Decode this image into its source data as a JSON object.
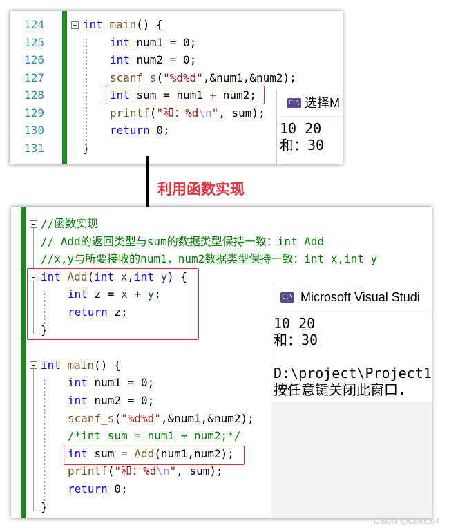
{
  "top_editor": {
    "line_numbers": [
      "124",
      "125",
      "126",
      "127",
      "128",
      "129",
      "130",
      "131"
    ],
    "lines": [
      [
        "kw:int",
        " ",
        "fn:main",
        "() {"
      ],
      [
        "kw:int",
        " num1 = 0;"
      ],
      [
        "kw:int",
        " num2 = 0;"
      ],
      [
        "fn:scanf_s",
        "(",
        "str:\"%d%d\"",
        ",&num1,&num2);"
      ],
      [
        "kw:int",
        " sum = num1 + num2;"
      ],
      [
        "fn:printf",
        "(",
        "str:\"和：%d",
        "esc:\\n",
        "str:\"",
        ", sum);"
      ],
      [
        "kw:return",
        " 0;"
      ],
      [
        "}"
      ]
    ],
    "console": {
      "title": "选择M",
      "output": [
        "10 20",
        "和：30"
      ]
    }
  },
  "arrow_label": "利用函数实现",
  "bottom_editor": {
    "lines": [
      [
        "cm://函数实现"
      ],
      [
        "cm:// Add的返回类型与sum的数据类型保持一致：int Add"
      ],
      [
        "cm://x,y与所要接收的num1，num2数据类型保持一致：int x,int y"
      ],
      [
        "kw:int",
        " ",
        "fn:Add",
        "(",
        "kw:int",
        " ",
        "var:x",
        ",",
        "kw:int",
        " ",
        "var:y",
        ") {"
      ],
      [
        "kw:int",
        " z = ",
        "var:x",
        " + ",
        "var:y",
        ";"
      ],
      [
        "kw:return",
        " z;"
      ],
      [
        "}"
      ],
      [
        ""
      ],
      [
        "kw:int",
        " ",
        "fn:main",
        "() {"
      ],
      [
        "kw:int",
        " num1 = 0;"
      ],
      [
        "kw:int",
        " num2 = 0;"
      ],
      [
        "fn:scanf_s",
        "(",
        "str:\"%d%d\"",
        ",&num1,&num2);"
      ],
      [
        "cm:/*int sum = num1 + num2;*/"
      ],
      [
        "kw:int",
        " sum = ",
        "fn:Add",
        "(num1,num2);"
      ],
      [
        "fn:printf",
        "(",
        "str:\"和：%d",
        "esc:\\n",
        "str:\"",
        ", sum);"
      ],
      [
        "kw:return",
        " 0;"
      ],
      [
        "}"
      ]
    ],
    "console": {
      "title": "Microsoft Visual Studi",
      "output": [
        "10 20",
        "和：30",
        "",
        "D:\\project\\Project1",
        "按任意键关闭此窗口."
      ]
    }
  },
  "watermark": "CSDN @Ctrl0104"
}
